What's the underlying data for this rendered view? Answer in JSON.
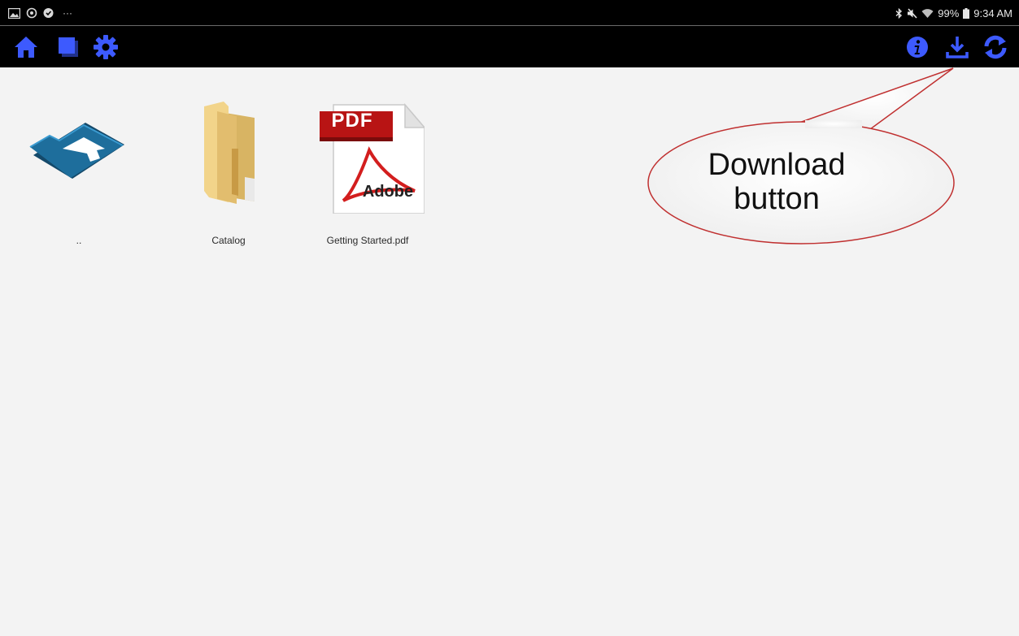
{
  "status_bar": {
    "left_icons": [
      "gallery-icon",
      "sync-icon",
      "shield-icon"
    ],
    "more": "···",
    "battery": "99%",
    "time": "9:34 AM"
  },
  "toolbar": {
    "left": [
      "home-icon",
      "library-icon",
      "settings-icon"
    ],
    "right": [
      "info-icon",
      "download-icon",
      "refresh-icon"
    ],
    "accent_color": "#3d5afe"
  },
  "files": [
    {
      "name": "..",
      "type": "parent-folder"
    },
    {
      "name": "Catalog",
      "type": "folder"
    },
    {
      "name": "Getting Started.pdf",
      "type": "pdf",
      "badge": "PDF",
      "brand": "Adobe"
    }
  ],
  "callout": {
    "line1": "Download",
    "line2": "button"
  }
}
